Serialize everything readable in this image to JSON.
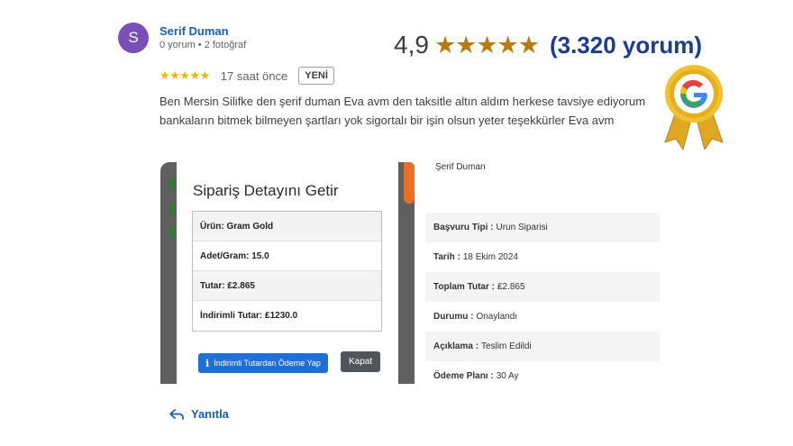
{
  "reviewer": {
    "initial": "S",
    "name": "Serif Duman",
    "meta": "0 yorum • 2 fotoğraf"
  },
  "rating": {
    "score": "4,9",
    "stars": "★★★★★",
    "count": "(3.320 yorum)"
  },
  "review": {
    "stars": "★★★★★",
    "time": "17 saat önce",
    "badge": "YENİ",
    "text": "Ben Mersin Silifke den şerif duman Eva avm den taksitle altın aldım herkese tavsiye ediyorum bankaların bitmek bilmeyen şartları yok sigortalı bir işin olsun yeter teşekkürler Eva avm"
  },
  "order_modal": {
    "title": "Sipariş Detayını Getir",
    "rows": [
      "Ürün: Gram Gold",
      "Adet/Gram: 15.0",
      "Tutar: ₤2.865",
      "İndirimli Tutar: ₤1230.0"
    ],
    "pay_button": "İndirimli Tutardan Ödeme Yap",
    "close_button": "Kapat"
  },
  "details": {
    "name": "Şerif Duman",
    "rows": [
      {
        "label": "Başvuru Tipi :",
        "value": "Urun Siparisi"
      },
      {
        "label": "Tarih :",
        "value": "18 Ekim 2024"
      },
      {
        "label": "Toplam Tutar :",
        "value": "₤2.865"
      },
      {
        "label": "Durumu :",
        "value": "Onaylandı"
      },
      {
        "label": "Açıklama :",
        "value": "Teslim Edildi"
      },
      {
        "label": "Ödeme Planı :",
        "value": "30 Ay"
      }
    ]
  },
  "reply_label": "Yanıtla",
  "colors": {
    "avatar": "#7b4fb8",
    "name": "#1a5fb4",
    "rating_stars": "#b97a10",
    "rating_count": "#1a3d8f",
    "pay_button": "#1f6fd6"
  }
}
